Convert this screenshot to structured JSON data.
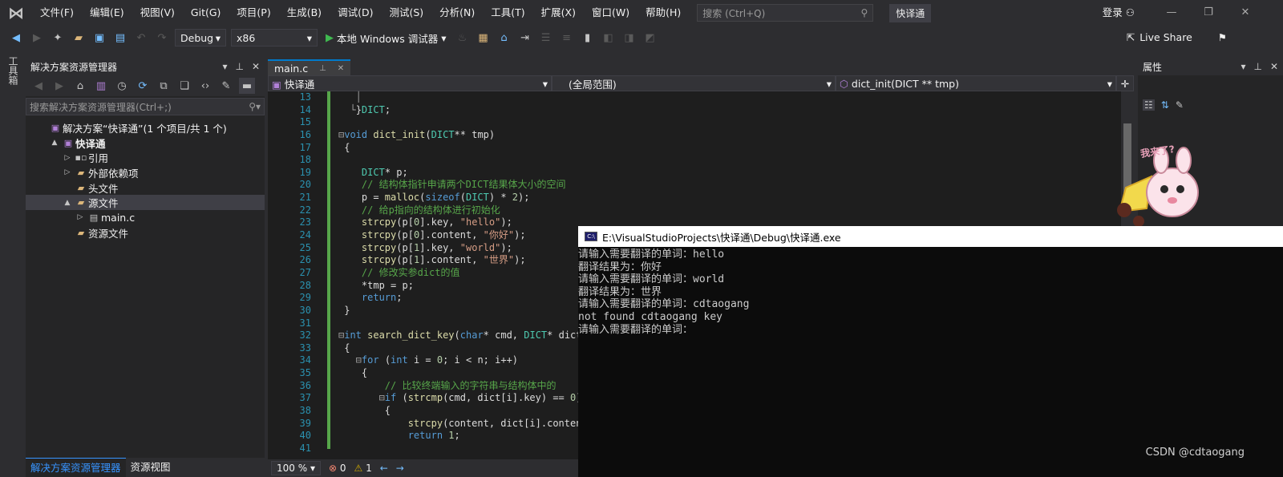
{
  "menu": {
    "items": [
      "文件(F)",
      "编辑(E)",
      "视图(V)",
      "Git(G)",
      "项目(P)",
      "生成(B)",
      "调试(D)",
      "测试(S)",
      "分析(N)",
      "工具(T)",
      "扩展(X)",
      "窗口(W)",
      "帮助(H)"
    ],
    "search_placeholder": "搜索 (Ctrl+Q)",
    "solution_name": "快译通",
    "login": "登录"
  },
  "toolbar": {
    "config": "Debug",
    "platform": "x86",
    "run_label": "本地 Windows 调试器",
    "live_share": "Live Share"
  },
  "left_strip": {
    "label": "工具箱"
  },
  "solution_explorer": {
    "title": "解决方案资源管理器",
    "search_placeholder": "搜索解决方案资源管理器(Ctrl+;)",
    "tree": [
      {
        "label": "解决方案“快译通”(1 个项目/共 1 个)",
        "icon": "vs-solution-icon",
        "indent": 0,
        "arrow": ""
      },
      {
        "label": "快译通",
        "icon": "vs-project-icon",
        "indent": 1,
        "arrow": "▲",
        "bold": true
      },
      {
        "label": "引用",
        "icon": "reference-icon",
        "indent": 2,
        "arrow": "▷"
      },
      {
        "label": "外部依赖项",
        "icon": "folder-icon",
        "indent": 2,
        "arrow": "▷"
      },
      {
        "label": "头文件",
        "icon": "folder-icon",
        "indent": 2,
        "arrow": ""
      },
      {
        "label": "源文件",
        "icon": "folder-icon",
        "indent": 2,
        "arrow": "▲",
        "selected": true
      },
      {
        "label": "main.c",
        "icon": "c-file-icon",
        "indent": 3,
        "arrow": "▷"
      },
      {
        "label": "资源文件",
        "icon": "folder-icon",
        "indent": 2,
        "arrow": ""
      }
    ],
    "bottom_tabs": [
      "解决方案资源管理器",
      "资源视图"
    ]
  },
  "editor": {
    "tab": "main.c",
    "nav_project": "快译通",
    "nav_scope": "(全局范围)",
    "nav_member": "dict_init(DICT ** tmp)",
    "line_numbers": [
      "13",
      "14",
      "15",
      "16",
      "17",
      "18",
      "19",
      "20",
      "21",
      "22",
      "23",
      "24",
      "25",
      "26",
      "27",
      "28",
      "29",
      "30",
      "31",
      "32",
      "33",
      "34",
      "35",
      "36",
      "37",
      "38",
      "39",
      "40",
      "41"
    ],
    "zoom": "100 %",
    "errors": "0",
    "warnings": "1"
  },
  "properties": {
    "title": "属性"
  },
  "sticker": {
    "text": "我来了?"
  },
  "console": {
    "title": "E:\\VisualStudioProjects\\快译通\\Debug\\快译通.exe",
    "lines": [
      "请输入需要翻译的单词：hello",
      "翻译结果为：你好",
      "请输入需要翻译的单词：world",
      "翻译结果为：世界",
      "请输入需要翻译的单词：cdtaogang",
      "not found cdtaogang key",
      "请输入需要翻译的单词："
    ]
  },
  "watermark": "CSDN @cdtaogang",
  "colors": {
    "accent": "#007acc",
    "bg": "#1e1e1e",
    "gutter_green": "#57a64a"
  }
}
